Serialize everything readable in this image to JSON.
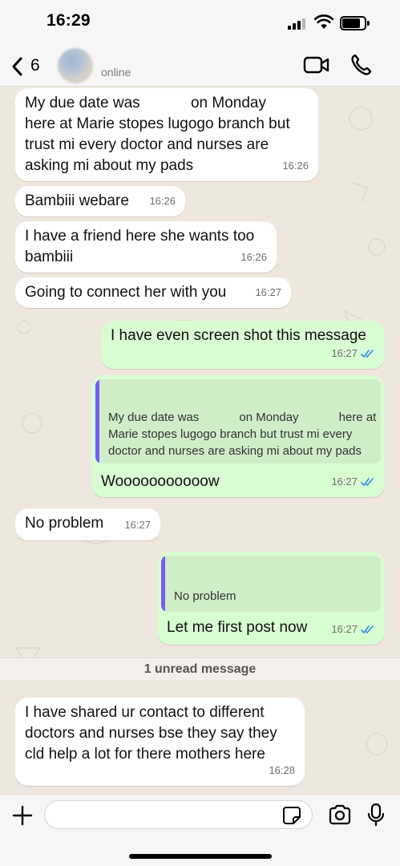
{
  "status_bar": {
    "time": "16:29"
  },
  "header": {
    "back_count": "6",
    "contact_status": "online"
  },
  "icons": {
    "back": "chevron-left-icon",
    "video": "video-camera-icon",
    "phone": "phone-icon",
    "plus": "plus-icon",
    "sticker": "sticker-icon",
    "camera": "camera-icon",
    "mic": "microphone-icon",
    "read_receipt": "double-check-icon"
  },
  "colors": {
    "incoming_bubble": "#ffffff",
    "outgoing_bubble": "#d9fdd3",
    "quote_bar": "#7a5af5",
    "read_ticks": "#2f8cf0",
    "chat_background": "#efe7de"
  },
  "messages": [
    {
      "direction": "in",
      "lines": [
        "My due date was            on Monday",
        "here at Marie stopes lugogo branch but",
        "trust mi every doctor and nurses are",
        "asking mi about my pads"
      ],
      "time": "16:26"
    },
    {
      "direction": "in",
      "lines": [
        "Bambiii webare"
      ],
      "time": "16:26"
    },
    {
      "direction": "in",
      "lines": [
        "I have a friend here she wants too",
        "bambiii"
      ],
      "time": "16:26"
    },
    {
      "direction": "in",
      "lines": [
        "Going to connect her with you"
      ],
      "time": "16:27"
    },
    {
      "direction": "out",
      "lines": [
        "I have even screen shot this message"
      ],
      "time": "16:27"
    },
    {
      "direction": "out",
      "quote_lines": [
        "My due date was            on Monday            here at",
        "Marie stopes lugogo branch but trust mi every",
        "doctor and nurses are asking mi about my pads"
      ],
      "lines": [
        "Wooooooooooow"
      ],
      "time": "16:27"
    },
    {
      "direction": "in",
      "lines": [
        "No problem"
      ],
      "time": "16:27"
    },
    {
      "direction": "out",
      "quote_lines": [
        "No problem"
      ],
      "lines": [
        "Let me first post now"
      ],
      "time": "16:27"
    },
    {
      "direction": "in",
      "lines": [
        "I have shared ur contact to different",
        "doctors and nurses bse they say they",
        "cld help a lot for there mothers here"
      ],
      "time": "16:28"
    }
  ],
  "unread_banner": "1 unread message",
  "composer": {
    "value": "",
    "placeholder": ""
  }
}
